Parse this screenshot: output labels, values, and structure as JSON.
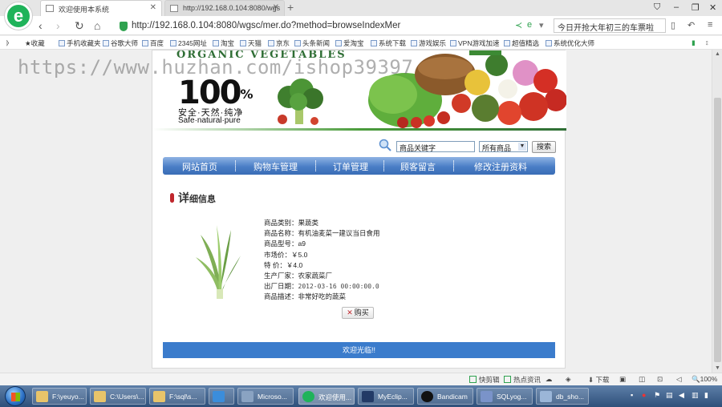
{
  "browser": {
    "tabs": [
      {
        "label": "欢迎使用本系统",
        "active": true
      },
      {
        "label": "http://192.168.0.104:8080/wgs",
        "active": false
      }
    ],
    "url": "http://192.168.0.104:8080/wgsc/mer.do?method=browseIndexMer",
    "search_text": "今日开抢大年初三的车票啦",
    "bookmarks": [
      "收藏",
      "手机收藏夹",
      "谷歌大师",
      "百度",
      "2345网址",
      "淘宝",
      "天猫",
      "京东",
      "头条新闻",
      "爱淘宝",
      "系统下载",
      "游戏娱乐",
      "VPN游戏加速",
      "超值精选",
      "系统优化大师"
    ]
  },
  "watermark": "https://www.huzhan.com/ishop39397",
  "banner": {
    "organic": "ORGANIC VEGETABLES",
    "big": "100",
    "pct": "%",
    "tag_cn": "安全·天然·纯净",
    "tag_en": "Safe·natural·pure"
  },
  "search": {
    "keyword": "商品关键字",
    "category": "所有商品",
    "button": "搜索"
  },
  "menu": [
    "网站首页",
    "购物车管理",
    "订单管理",
    "顾客留言",
    "修改注册资料"
  ],
  "detail": {
    "title_big": "详",
    "title_small": "细信息",
    "rows": [
      {
        "label": "商品类别：",
        "value": "果蔬类"
      },
      {
        "label": "商品名称：",
        "value": "有机油麦菜一建议当日食用"
      },
      {
        "label": "商品型号：",
        "value": "a9"
      },
      {
        "label": "市场价：",
        "value": "￥5.0"
      },
      {
        "label": "特  价：",
        "value": "￥4.0"
      },
      {
        "label": "生产厂家：",
        "value": "农家蔬菜厂"
      },
      {
        "label": "出厂日期：",
        "value": "2012-03-16 00:00:00.0"
      },
      {
        "label": "商品描述：",
        "value": "非常好吃的蔬菜"
      }
    ],
    "buy_label": "购买"
  },
  "footer": "欢迎光临!!",
  "statusbar": {
    "left1": "快剪辑",
    "left2": "热点资讯",
    "download": "下载",
    "zoom": "100%"
  },
  "taskbar": {
    "items": [
      "F:\\yeuyo...",
      "C:\\Users\\...",
      "F:\\sql\\s...",
      "",
      "Microso...",
      "欢迎使用...",
      "MyEclip...",
      "Bandicam",
      "SQLyog...",
      "db_sho..."
    ]
  }
}
